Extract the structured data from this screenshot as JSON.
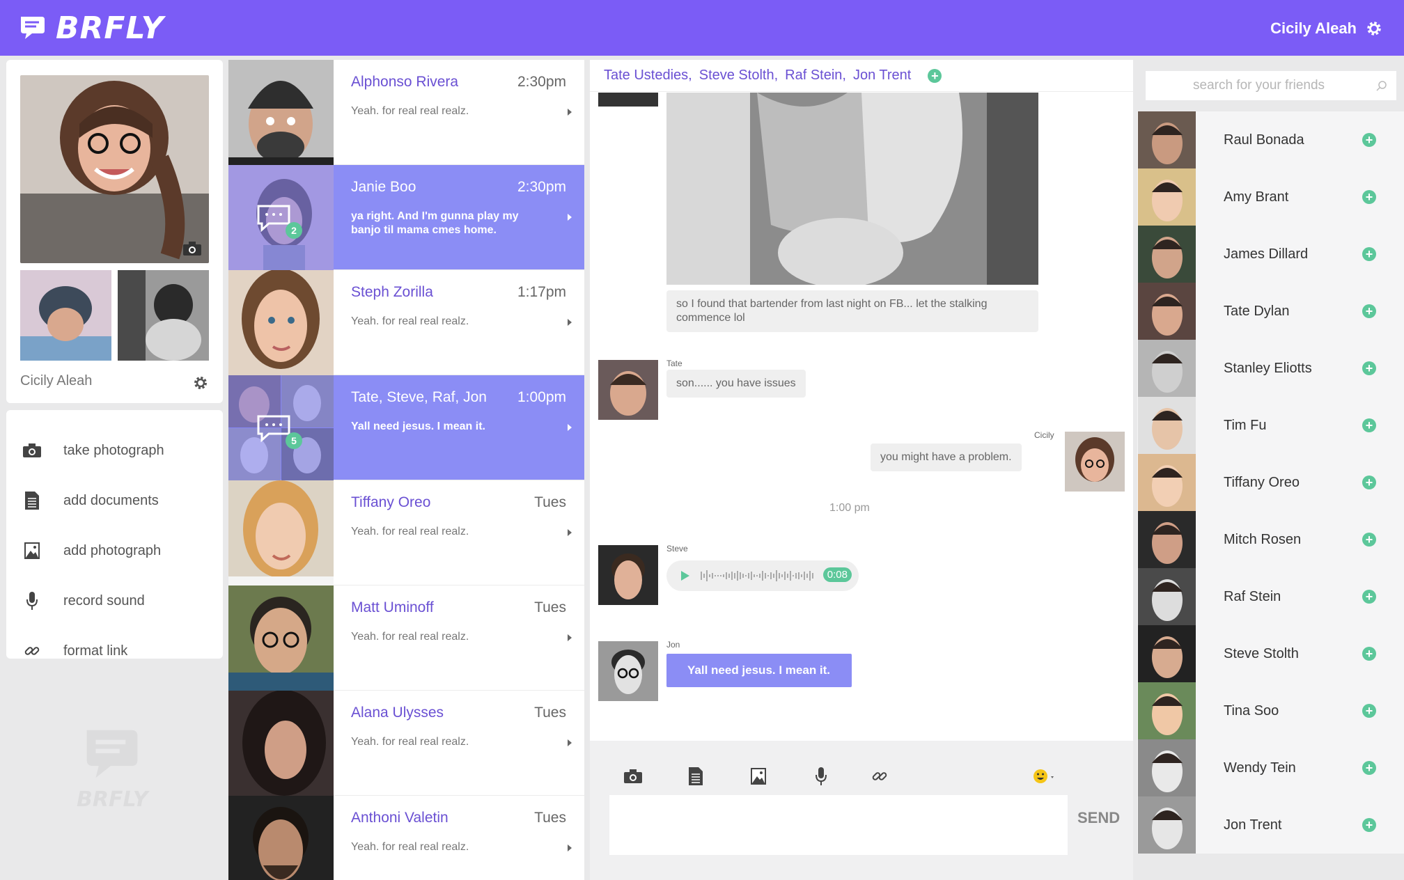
{
  "app": {
    "logo_text": "BRFLY",
    "user_name": "Cicily Aleah"
  },
  "profile": {
    "name": "Cicily Aleah"
  },
  "actions": [
    {
      "label": "take photograph",
      "icon": "camera-icon"
    },
    {
      "label": "add documents",
      "icon": "document-icon"
    },
    {
      "label": "add photograph",
      "icon": "image-icon"
    },
    {
      "label": "record sound",
      "icon": "microphone-icon"
    },
    {
      "label": "format link",
      "icon": "link-icon"
    }
  ],
  "watermark": "BRFLY",
  "conversations": [
    {
      "name": "Alphonso Rivera",
      "time": "2:30pm",
      "preview": "Yeah. for real real realz.",
      "active": false
    },
    {
      "name": "Janie Boo",
      "time": "2:30pm",
      "preview": "ya right. And I'm gunna play my banjo til mama cmes home.",
      "active": true,
      "badge": "2"
    },
    {
      "name": "Steph Zorilla",
      "time": "1:17pm",
      "preview": "Yeah. for real real realz.",
      "active": false
    },
    {
      "name": "Tate, Steve, Raf, Jon",
      "time": "1:00pm",
      "preview": "Yall need jesus. I mean it.",
      "active": true,
      "badge": "5"
    },
    {
      "name": "Tiffany Oreo",
      "time": "Tues",
      "preview": "Yeah. for real real realz.",
      "active": false
    },
    {
      "name": "Matt Uminoff",
      "time": "Tues",
      "preview": "Yeah. for real real realz.",
      "active": false
    },
    {
      "name": "Alana Ulysses",
      "time": "Tues",
      "preview": "Yeah. for real real realz.",
      "active": false
    },
    {
      "name": "Anthoni Valetin",
      "time": "Tues",
      "preview": "Yeah. for real real realz.",
      "active": false
    }
  ],
  "chat": {
    "participants": [
      "Tate Ustedies,",
      "Steve Stolth,",
      "Raf Stein,",
      "Jon Trent"
    ],
    "messages": {
      "photo_caption": "so I found that bartender from last night on FB... let the stalking commence lol",
      "tate_sender": "Tate",
      "tate_text": "son...... you have issues",
      "cicily_sender": "Cicily",
      "cicily_text": "you might have a problem.",
      "timestamp": "1:00 pm",
      "steve_sender": "Steve",
      "steve_audio_duration": "0:08",
      "jon_sender": "Jon",
      "jon_text": "Yall need jesus. I mean it."
    },
    "composer": {
      "placeholder": "",
      "send_label": "SEND"
    }
  },
  "friends": {
    "search_placeholder": "search for your friends",
    "list": [
      "Raul Bonada",
      "Amy Brant",
      "James Dillard",
      "Tate Dylan",
      "Stanley Eliotts",
      "Tim Fu",
      "Tiffany Oreo",
      "Mitch Rosen",
      "Raf Stein",
      "Steve Stolth",
      "Tina Soo",
      "Wendy Tein",
      "Jon Trent"
    ]
  },
  "colors": {
    "brand": "#7b5cf6",
    "active_row": "#8b8df5",
    "accent_green": "#5cc79a",
    "name_purple": "#6a50d3"
  }
}
